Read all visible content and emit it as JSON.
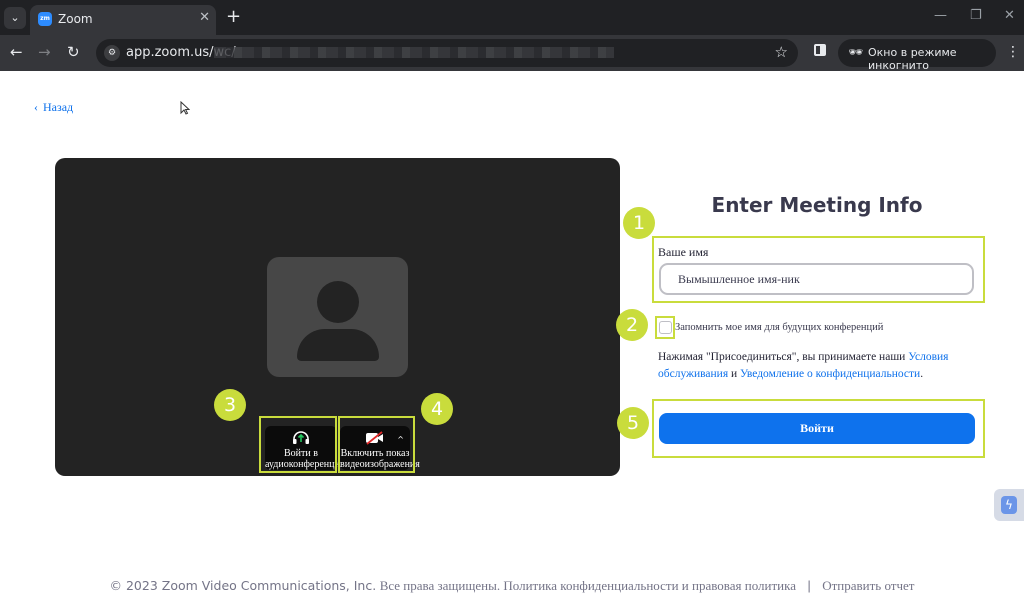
{
  "browser": {
    "tab_title": "Zoom",
    "favicon_text": "zm",
    "url": "app.zoom.us/wc/",
    "incognito_label": "Окно в режиме инкогнито"
  },
  "page": {
    "back_label": "Назад",
    "title": "Enter Meeting Info",
    "name_label": "Ваше имя",
    "name_value": "Вымышленное имя-ник",
    "remember_label": "Запомнить мое имя для будущих конференций",
    "terms": {
      "prefix": "Нажимая \"Присоединиться\", вы принимаете наши",
      "terms_link": "Условия обслуживания",
      "conjunction": "и",
      "privacy_link": "Уведомление о конфиденциальности",
      "suffix": "."
    },
    "join_button": "Войти",
    "audio_button": "Войти в аудиоконференцию",
    "video_button": "Включить показ видеоизображения"
  },
  "annotations": {
    "badges": [
      "1",
      "2",
      "3",
      "4",
      "5"
    ],
    "color": "#c9dc3c"
  },
  "footer": {
    "copyright": "© 2023 Zoom Video Communications, Inc.",
    "rights": "Все права защищены. Политика конфиденциальности и правовая политика",
    "separator": "|",
    "feedback": "Отправить отчет"
  },
  "colors": {
    "accent": "#0e72ed",
    "link": "#0e71eb",
    "video_bg": "#232323"
  }
}
